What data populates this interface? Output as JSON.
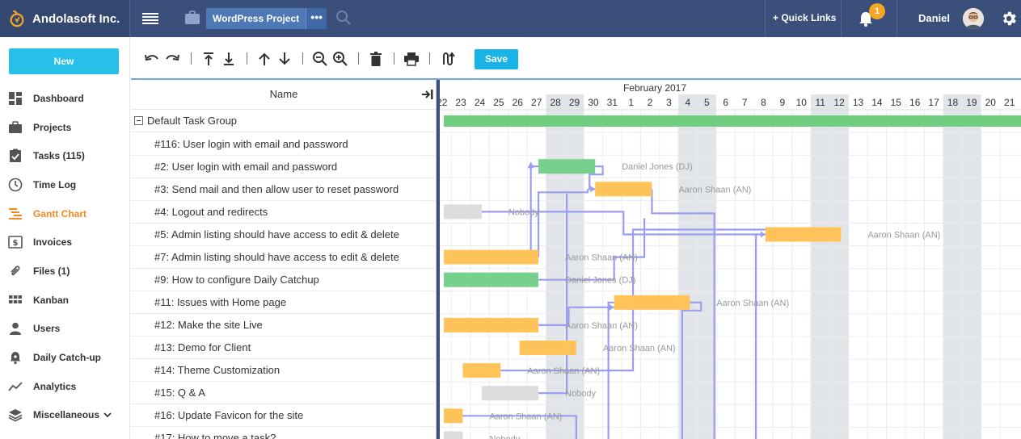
{
  "brand": {
    "name": "Andolasoft Inc."
  },
  "header": {
    "project": "WordPress Project",
    "project_more": "•••",
    "quick_links": "+ Quick Links",
    "notifications": "1",
    "user": "Daniel"
  },
  "sidebar": {
    "new_label": "New",
    "items": [
      {
        "label": "Dashboard",
        "icon": "dashboard-icon"
      },
      {
        "label": "Projects",
        "icon": "briefcase-icon"
      },
      {
        "label": "Tasks (115)",
        "icon": "clipboard-check-icon"
      },
      {
        "label": "Time Log",
        "icon": "clock-icon"
      },
      {
        "label": "Gantt Chart",
        "icon": "gantt-icon"
      },
      {
        "label": "Invoices",
        "icon": "invoice-icon"
      },
      {
        "label": "Files  (1)",
        "icon": "paperclip-icon"
      },
      {
        "label": "Kanban",
        "icon": "kanban-icon"
      },
      {
        "label": "Users",
        "icon": "user-icon"
      },
      {
        "label": "Daily Catch-up",
        "icon": "bell-plus-icon"
      },
      {
        "label": "Analytics",
        "icon": "analytics-icon"
      },
      {
        "label": "Miscellaneous",
        "icon": "layers-icon"
      }
    ]
  },
  "toolbar": {
    "save_label": "Save"
  },
  "grid": {
    "column_name": "Name",
    "group": "Default Task Group",
    "tasks": [
      "#116: User login with email and password",
      "#2: User login with email and password",
      "#3: Send mail and then allow user to reset password",
      "#4: Logout and redirects",
      "#5: Admin listing should have access to edit & delete",
      "#7: Admin listing should have access to edit & delete",
      "#9: How to configure Daily Catchup",
      "#11: Issues with Home page",
      "#12: Make the site Live",
      "#13: Demo for Client",
      "#14: Theme Customization",
      "#15: Q & A",
      "#16: Update Favicon for the site",
      "#17: How to move  a task?"
    ]
  },
  "timeline": {
    "month": "February 2017",
    "days": [
      "22",
      "23",
      "24",
      "25",
      "26",
      "27",
      "28",
      "29",
      "30",
      "31",
      "1",
      "2",
      "3",
      "4",
      "5",
      "6",
      "7",
      "8",
      "9",
      "10",
      "11",
      "12",
      "13",
      "14",
      "15",
      "16",
      "17",
      "18",
      "19",
      "20",
      "21"
    ],
    "weekend_index": [
      6,
      7,
      13,
      14,
      20,
      21,
      27,
      28
    ],
    "colors": {
      "green": "#77d08e",
      "orange": "#ffc35a",
      "gray": "#dddddd",
      "summary": "#6fcf7e",
      "link": "#9b9ef0"
    },
    "bars": [
      {
        "row": 2,
        "start": 5.6,
        "dur": 3.0,
        "color": "green",
        "label": "Daniel Jones (DJ)"
      },
      {
        "row": 3,
        "start": 8.6,
        "dur": 3.0,
        "color": "orange",
        "label": "Aaron Shaan (AN)"
      },
      {
        "row": 4,
        "start": 0.6,
        "dur": 2.0,
        "color": "gray",
        "label": "Nobody"
      },
      {
        "row": 5,
        "start": 17.6,
        "dur": 4.0,
        "color": "orange",
        "label": "Aaron Shaan (AN)"
      },
      {
        "row": 6,
        "start": 0.6,
        "dur": 5.0,
        "color": "orange",
        "label": "Aaron Shaan (AN)"
      },
      {
        "row": 7,
        "start": 0.6,
        "dur": 5.0,
        "color": "green",
        "label": "Daniel Jones (DJ)"
      },
      {
        "row": 8,
        "start": 9.6,
        "dur": 4.0,
        "color": "orange",
        "label": "Aaron Shaan (AN)"
      },
      {
        "row": 9,
        "start": 0.6,
        "dur": 5.0,
        "color": "orange",
        "label": "Aaron Shaan (AN)"
      },
      {
        "row": 10,
        "start": 4.6,
        "dur": 3.0,
        "color": "orange",
        "label": "Aaron Shaan (AN)"
      },
      {
        "row": 11,
        "start": 1.6,
        "dur": 2.0,
        "color": "orange",
        "label": "Aaron Shaan (AN)"
      },
      {
        "row": 12,
        "start": 2.6,
        "dur": 3.0,
        "color": "gray",
        "label": "Nobody"
      },
      {
        "row": 13,
        "start": 0.6,
        "dur": 1.0,
        "color": "orange",
        "label": "Aaron Shaan (AN)"
      },
      {
        "row": 14,
        "start": 0.6,
        "dur": 1.0,
        "color": "gray",
        "label": "Nobody"
      }
    ]
  }
}
